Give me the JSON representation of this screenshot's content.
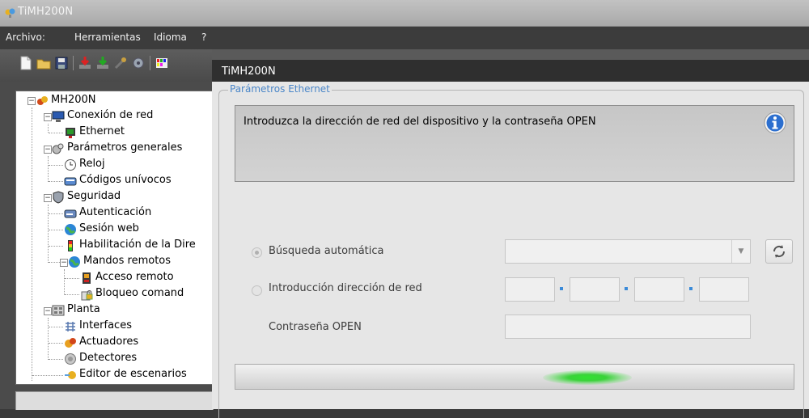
{
  "app": {
    "window_title": "TiMH200N",
    "menu": [
      "Archivo:",
      "Herramientas",
      "Idioma",
      "?"
    ]
  },
  "toolbar": {
    "icons": [
      "new-file-icon",
      "open-folder-icon",
      "save-icon",
      "download-red-icon",
      "download-green-icon",
      "tools-icon",
      "settings-icon",
      "palette-icon"
    ]
  },
  "tree": {
    "root": "MH200N",
    "items": [
      {
        "label": "Conexión de red",
        "icon": "network-monitor-icon"
      },
      {
        "label": "Ethernet",
        "icon": "ethernet-icon"
      },
      {
        "label": "Parámetros generales",
        "icon": "gears-icon"
      },
      {
        "label": "Reloj",
        "icon": "clock-icon"
      },
      {
        "label": "Códigos unívocos",
        "icon": "codes-icon"
      },
      {
        "label": "Seguridad",
        "icon": "shield-icon"
      },
      {
        "label": "Autenticación",
        "icon": "authentication-icon"
      },
      {
        "label": "Sesión web",
        "icon": "globe-icon"
      },
      {
        "label": "Habilitación de la Dire",
        "icon": "enable-icon"
      },
      {
        "label": "Mandos remotos",
        "icon": "remote-globe-icon"
      },
      {
        "label": "Acceso remoto",
        "icon": "remote-access-icon"
      },
      {
        "label": "Bloqueo comand",
        "icon": "lock-command-icon"
      },
      {
        "label": "Planta",
        "icon": "plant-icon"
      },
      {
        "label": "Interfaces",
        "icon": "interfaces-icon"
      },
      {
        "label": "Actuadores",
        "icon": "actuators-icon"
      },
      {
        "label": "Detectores",
        "icon": "detectors-icon"
      },
      {
        "label": "Editor de escenarios",
        "icon": "scenario-editor-icon"
      }
    ]
  },
  "child_window": {
    "title": "TiMH200N",
    "group_title": "Parámetros Ethernet",
    "info_text": "Introduzca la dirección de red del dispositivo y la contraseña OPEN",
    "option_auto": "Búsqueda automática",
    "option_manual": "Introducción dirección de red",
    "password_label": "Contraseña OPEN",
    "auto_combo_value": "",
    "ip": [
      "",
      "",
      "",
      ""
    ],
    "password_value": ""
  },
  "colors": {
    "group_title": "#4a86c8",
    "progress_glow": "#2fe32f",
    "ip_dot": "#3a8ad8"
  }
}
